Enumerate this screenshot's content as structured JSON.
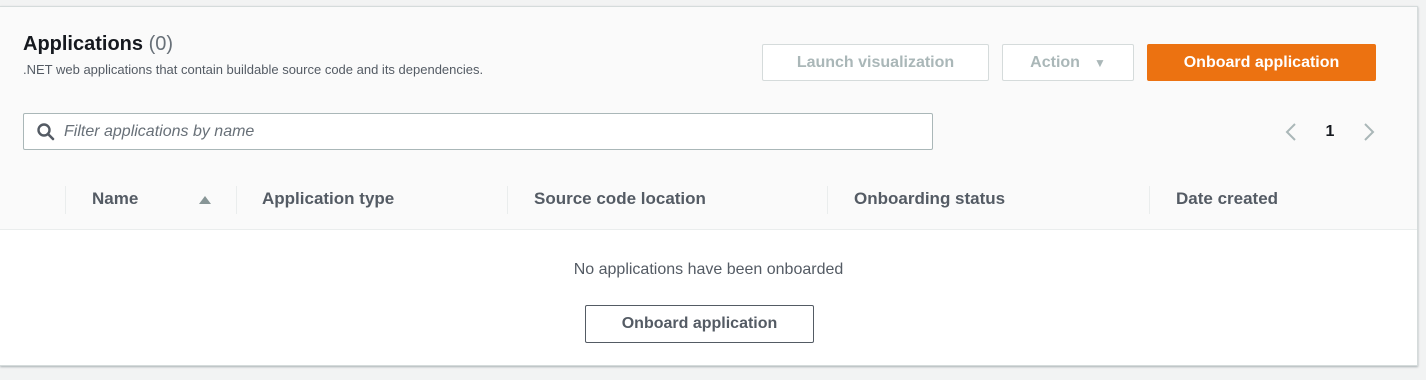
{
  "header": {
    "title": "Applications",
    "count": "(0)",
    "description": ".NET web applications that contain buildable source code and its dependencies."
  },
  "actions": {
    "launch_label": "Launch visualization",
    "action_label": "Action",
    "onboard_label": "Onboard application"
  },
  "search": {
    "placeholder": "Filter applications by name",
    "icon": "search-icon"
  },
  "pagination": {
    "current_page": "1"
  },
  "table": {
    "columns": [
      "Name",
      "Application type",
      "Source code location",
      "Onboarding status",
      "Date created"
    ],
    "rows": []
  },
  "empty_state": {
    "message": "No applications have been onboarded",
    "button_label": "Onboard application"
  },
  "colors": {
    "primary": "#ec7211",
    "background": "#f2f3f3"
  }
}
